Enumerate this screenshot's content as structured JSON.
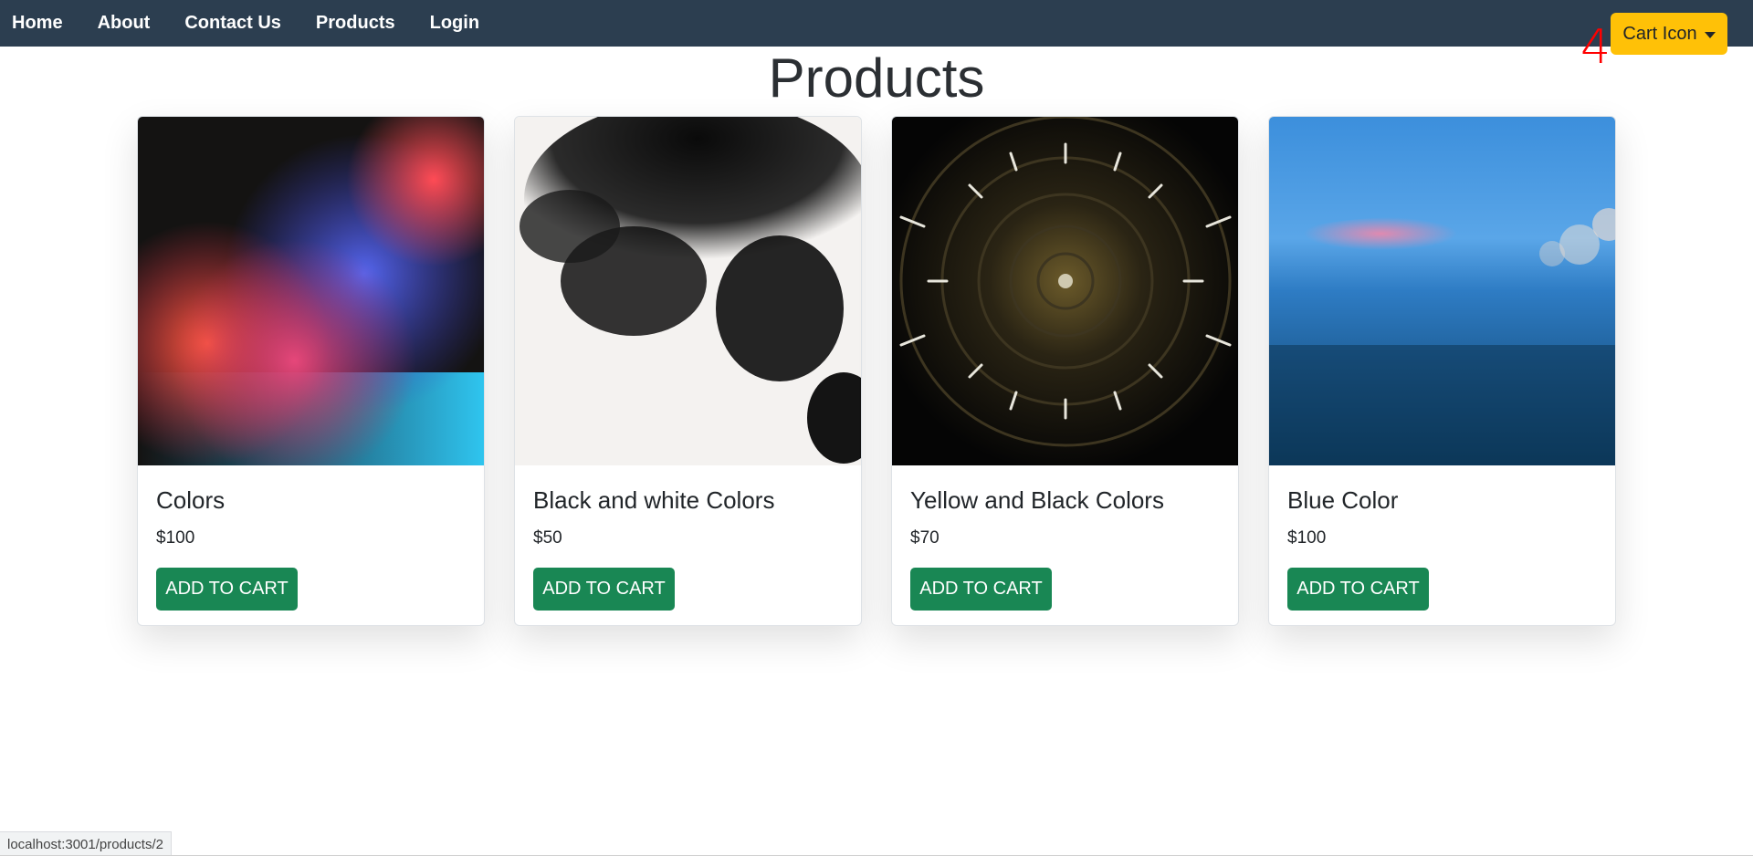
{
  "nav": {
    "links": [
      "Home",
      "About",
      "Contact Us",
      "Products",
      "Login"
    ],
    "cart_label": "Cart Icon",
    "cart_count": "4"
  },
  "page": {
    "title": "Products"
  },
  "products": [
    {
      "title": "Colors",
      "price": "$100",
      "button": "ADD TO CART",
      "image": "colorful-smoke-image"
    },
    {
      "title": "Black and white Colors",
      "price": "$50",
      "button": "ADD TO CART",
      "image": "black-ink-image"
    },
    {
      "title": "Yellow and Black Colors",
      "price": "$70",
      "button": "ADD TO CART",
      "image": "radial-lights-image"
    },
    {
      "title": "Blue Color",
      "price": "$100",
      "button": "ADD TO CART",
      "image": "blue-bokeh-image"
    }
  ],
  "status_bar": {
    "url": "localhost:3001/products/2"
  },
  "colors": {
    "navbar": "#2c3e50",
    "cart_button": "#ffc107",
    "add_button": "#198754",
    "count": "#ff0000"
  }
}
